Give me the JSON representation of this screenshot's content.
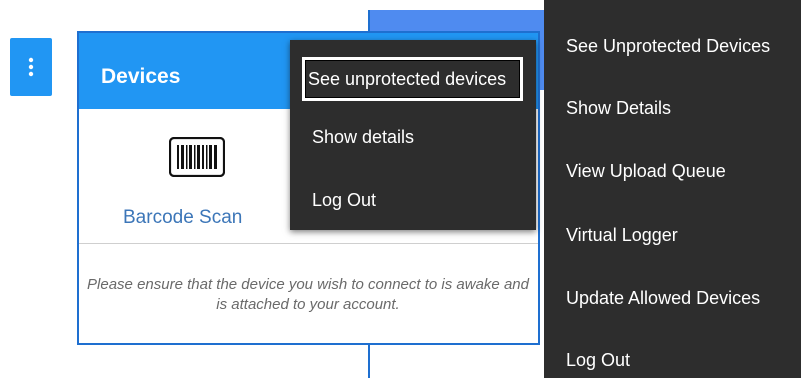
{
  "devices_card": {
    "title": "Devices",
    "barcode_label": "Barcode Scan",
    "help_text": "Please ensure that the device you wish to connect to is awake and is attached to your account."
  },
  "small_menu": {
    "items": [
      "See unprotected devices",
      "Show details",
      "Log Out"
    ]
  },
  "large_menu": {
    "items": [
      "See Unprotected Devices",
      "Show Details",
      "View Upload Queue",
      "Virtual Logger",
      "Update Allowed Devices",
      "Log Out"
    ]
  },
  "colors": {
    "header_blue": "#2196f3",
    "menu_bg": "#2d2d2d",
    "link_blue": "#3c76b8",
    "border_blue": "#1e6fd0"
  },
  "icons": [
    "more-vertical-icon",
    "barcode-icon"
  ]
}
